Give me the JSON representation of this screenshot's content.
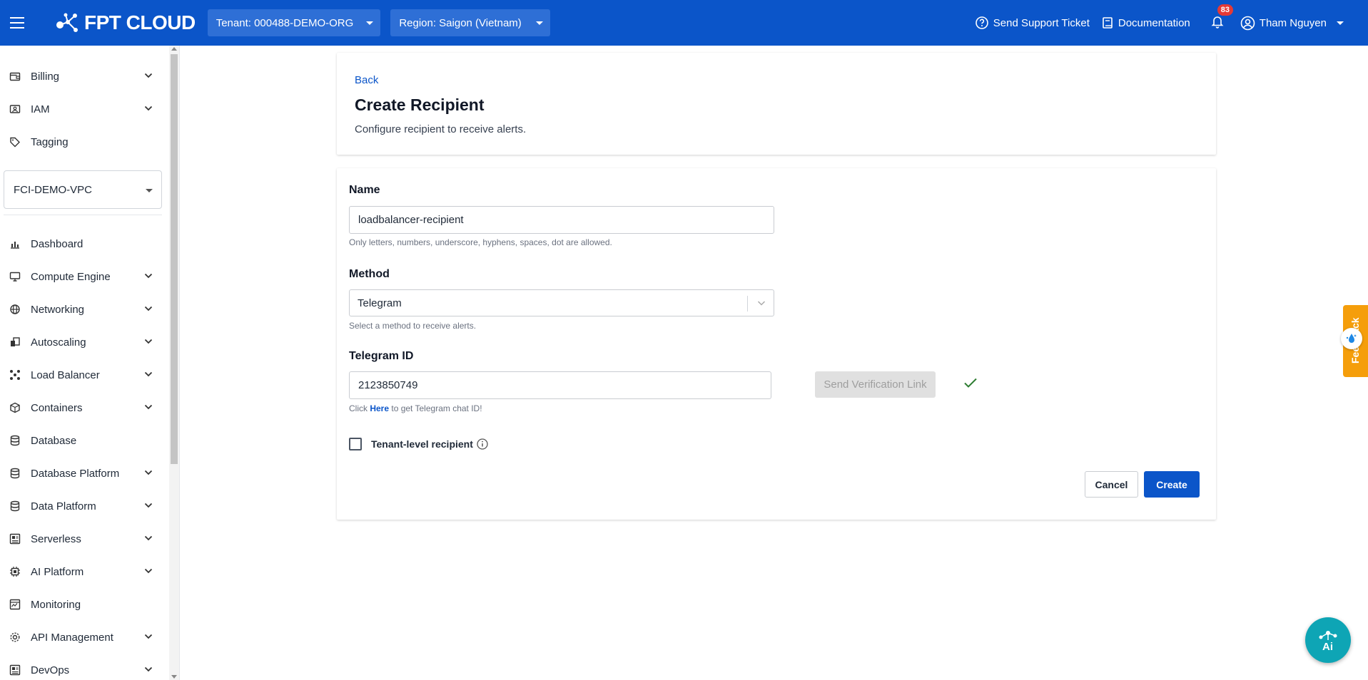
{
  "topbar": {
    "logo_text": "FPT CLOUD",
    "tenant_label": "Tenant: 000488-DEMO-ORG",
    "region_label": "Region: Saigon (Vietnam)",
    "support_label": "Send Support Ticket",
    "docs_label": "Documentation",
    "notification_count": "83",
    "user_name": "Tham Nguyen"
  },
  "sidebar": {
    "top_items": [
      {
        "label": "Billing",
        "icon": "wallet-icon",
        "expandable": true
      },
      {
        "label": "IAM",
        "icon": "id-card-icon",
        "expandable": true
      },
      {
        "label": "Tagging",
        "icon": "tag-icon",
        "expandable": false
      }
    ],
    "vpc_selected": "FCI-DEMO-VPC",
    "items": [
      {
        "label": "Dashboard",
        "icon": "bar-chart-icon",
        "expandable": false
      },
      {
        "label": "Compute Engine",
        "icon": "monitor-icon",
        "expandable": true
      },
      {
        "label": "Networking",
        "icon": "globe-icon",
        "expandable": true
      },
      {
        "label": "Autoscaling",
        "icon": "autoscaling-icon",
        "expandable": true
      },
      {
        "label": "Load Balancer",
        "icon": "load-balancer-icon",
        "expandable": true
      },
      {
        "label": "Containers",
        "icon": "cube-icon",
        "expandable": true
      },
      {
        "label": "Database",
        "icon": "database-icon",
        "expandable": false
      },
      {
        "label": "Database Platform",
        "icon": "database-icon",
        "expandable": true
      },
      {
        "label": "Data Platform",
        "icon": "database-icon",
        "expandable": true
      },
      {
        "label": "Serverless",
        "icon": "serverless-icon",
        "expandable": true
      },
      {
        "label": "AI Platform",
        "icon": "chip-icon",
        "expandable": true
      },
      {
        "label": "Monitoring",
        "icon": "monitoring-icon",
        "expandable": false
      },
      {
        "label": "API Management",
        "icon": "gear-icon",
        "expandable": true
      },
      {
        "label": "DevOps",
        "icon": "devops-icon",
        "expandable": true
      }
    ]
  },
  "header_card": {
    "back_label": "Back",
    "title": "Create Recipient",
    "subtitle": "Configure recipient to receive alerts."
  },
  "form": {
    "name_label": "Name",
    "name_value": "loadbalancer-recipient",
    "name_help": "Only letters, numbers, underscore, hyphens, spaces, dot are allowed.",
    "method_label": "Method",
    "method_value": "Telegram",
    "method_help": "Select a method to receive alerts.",
    "telegram_label": "Telegram ID",
    "telegram_value": "2123850749",
    "telegram_help_prefix": "Click ",
    "telegram_help_link": "Here",
    "telegram_help_suffix": " to get Telegram chat ID!",
    "verify_button": "Send Verification Link",
    "tenant_checkbox_label": "Tenant-level recipient",
    "tenant_checkbox_checked": false,
    "cancel_button": "Cancel",
    "create_button": "Create"
  },
  "widgets": {
    "feedback_label": "Feedback"
  },
  "colors": {
    "brand_blue": "#0b55c9",
    "feedback_orange": "#f59e0b",
    "success_green": "#2e7d32"
  }
}
